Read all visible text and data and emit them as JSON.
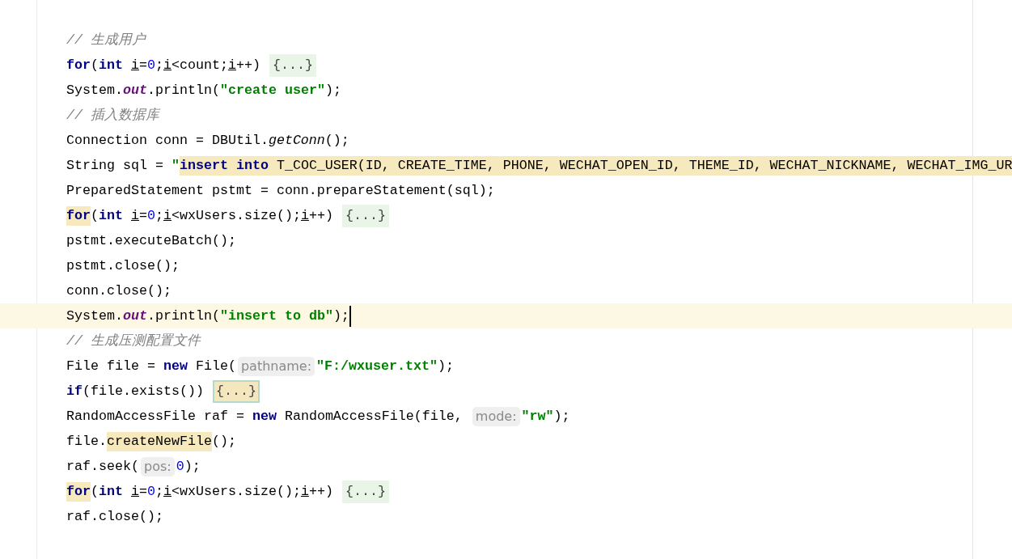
{
  "editor": {
    "lines": [
      {
        "current": false,
        "tokens": [
          {
            "kind": "comment",
            "text": "// 生成用户",
            "highlighted": false
          }
        ]
      },
      {
        "current": false,
        "tokens": [
          {
            "kind": "keyword",
            "text": "for",
            "highlighted": false
          },
          {
            "kind": "code",
            "text": "(",
            "highlighted": false
          },
          {
            "kind": "keyword",
            "text": "int ",
            "highlighted": false
          },
          {
            "kind": "var",
            "text": "i",
            "highlighted": false
          },
          {
            "kind": "code",
            "text": "=",
            "highlighted": false
          },
          {
            "kind": "number",
            "text": "0",
            "highlighted": false
          },
          {
            "kind": "code",
            "text": ";",
            "highlighted": false
          },
          {
            "kind": "var",
            "text": "i",
            "highlighted": false
          },
          {
            "kind": "code",
            "text": "<count;",
            "highlighted": false
          },
          {
            "kind": "var",
            "text": "i",
            "highlighted": false
          },
          {
            "kind": "code",
            "text": "++)",
            "highlighted": false
          },
          {
            "kind": "fold",
            "text": "{...}",
            "selected": false
          }
        ]
      },
      {
        "current": false,
        "tokens": [
          {
            "kind": "code",
            "text": "System.",
            "highlighted": false
          },
          {
            "kind": "field",
            "text": "out",
            "highlighted": false
          },
          {
            "kind": "code",
            "text": ".println(",
            "highlighted": false
          },
          {
            "kind": "string",
            "text": "\"create user\"",
            "highlighted": false
          },
          {
            "kind": "code",
            "text": ");",
            "highlighted": false
          }
        ]
      },
      {
        "current": false,
        "tokens": [
          {
            "kind": "comment",
            "text": "// 插入数据库",
            "highlighted": false
          }
        ]
      },
      {
        "current": false,
        "tokens": [
          {
            "kind": "code",
            "text": "Connection conn = DBUtil.",
            "highlighted": false
          },
          {
            "kind": "static",
            "text": "getConn",
            "highlighted": false
          },
          {
            "kind": "code",
            "text": "();",
            "highlighted": false
          }
        ]
      },
      {
        "current": false,
        "tokens": [
          {
            "kind": "code",
            "text": "String sql = ",
            "highlighted": false
          },
          {
            "kind": "string",
            "text": "\"",
            "highlighted": false
          },
          {
            "kind": "keyword",
            "text": "insert into",
            "highlighted": true
          },
          {
            "kind": "code",
            "text": " T_COC_USER(ID, CREATE_TIME, PHONE, WECHAT_OPEN_ID, THEME_ID, WECHAT_NICKNAME, WECHAT_IMG_UR",
            "highlighted": true
          }
        ]
      },
      {
        "current": false,
        "tokens": [
          {
            "kind": "code",
            "text": "PreparedStatement pstmt = conn.prepareStatement(sql);",
            "highlighted": false
          }
        ]
      },
      {
        "current": false,
        "tokens": [
          {
            "kind": "keyword",
            "text": "for",
            "highlighted": true
          },
          {
            "kind": "code",
            "text": "(",
            "highlighted": false
          },
          {
            "kind": "keyword",
            "text": "int ",
            "highlighted": false
          },
          {
            "kind": "var",
            "text": "i",
            "highlighted": false
          },
          {
            "kind": "code",
            "text": "=",
            "highlighted": false
          },
          {
            "kind": "number",
            "text": "0",
            "highlighted": false
          },
          {
            "kind": "code",
            "text": ";",
            "highlighted": false
          },
          {
            "kind": "var",
            "text": "i",
            "highlighted": false
          },
          {
            "kind": "code",
            "text": "<wxUsers.size();",
            "highlighted": false
          },
          {
            "kind": "var",
            "text": "i",
            "highlighted": false
          },
          {
            "kind": "code",
            "text": "++)",
            "highlighted": false
          },
          {
            "kind": "fold",
            "text": "{...}",
            "selected": false
          }
        ]
      },
      {
        "current": false,
        "tokens": [
          {
            "kind": "code",
            "text": "pstmt.executeBatch();",
            "highlighted": false
          }
        ]
      },
      {
        "current": false,
        "tokens": [
          {
            "kind": "code",
            "text": "pstmt.close();",
            "highlighted": false
          }
        ]
      },
      {
        "current": false,
        "tokens": [
          {
            "kind": "code",
            "text": "conn.close();",
            "highlighted": false
          }
        ]
      },
      {
        "current": true,
        "tokens": [
          {
            "kind": "code",
            "text": "System.",
            "highlighted": false
          },
          {
            "kind": "field",
            "text": "out",
            "highlighted": false
          },
          {
            "kind": "code",
            "text": ".println(",
            "highlighted": false
          },
          {
            "kind": "string",
            "text": "\"insert to db\"",
            "highlighted": false
          },
          {
            "kind": "code",
            "text": ");",
            "highlighted": false
          }
        ]
      },
      {
        "current": false,
        "tokens": [
          {
            "kind": "comment",
            "text": "// 生成压测配置文件",
            "highlighted": false
          }
        ]
      },
      {
        "current": false,
        "tokens": [
          {
            "kind": "code",
            "text": "File file = ",
            "highlighted": false
          },
          {
            "kind": "keyword",
            "text": "new",
            "highlighted": false
          },
          {
            "kind": "code",
            "text": " File(",
            "highlighted": false
          },
          {
            "kind": "hint",
            "text": "pathname:"
          },
          {
            "kind": "string",
            "text": "\"F:/wxuser.txt\"",
            "highlighted": false
          },
          {
            "kind": "code",
            "text": ");",
            "highlighted": false
          }
        ]
      },
      {
        "current": false,
        "tokens": [
          {
            "kind": "keyword",
            "text": "if",
            "highlighted": false
          },
          {
            "kind": "code",
            "text": "(file.exists())",
            "highlighted": false
          },
          {
            "kind": "fold",
            "text": "{...}",
            "selected": true
          }
        ]
      },
      {
        "current": false,
        "tokens": [
          {
            "kind": "code",
            "text": "RandomAccessFile raf = ",
            "highlighted": false
          },
          {
            "kind": "keyword",
            "text": "new",
            "highlighted": false
          },
          {
            "kind": "code",
            "text": " RandomAccessFile(file, ",
            "highlighted": false
          },
          {
            "kind": "hint",
            "text": "mode:"
          },
          {
            "kind": "string",
            "text": "\"rw\"",
            "highlighted": false
          },
          {
            "kind": "code",
            "text": ");",
            "highlighted": false
          }
        ]
      },
      {
        "current": false,
        "tokens": [
          {
            "kind": "code",
            "text": "file.",
            "highlighted": false
          },
          {
            "kind": "code",
            "text": "createNewFile",
            "highlighted": true
          },
          {
            "kind": "code",
            "text": "();",
            "highlighted": false
          }
        ]
      },
      {
        "current": false,
        "tokens": [
          {
            "kind": "code",
            "text": "raf.seek(",
            "highlighted": false
          },
          {
            "kind": "hint",
            "text": "pos:"
          },
          {
            "kind": "number",
            "text": "0",
            "highlighted": false
          },
          {
            "kind": "code",
            "text": ");",
            "highlighted": false
          }
        ]
      },
      {
        "current": false,
        "tokens": [
          {
            "kind": "keyword",
            "text": "for",
            "highlighted": true
          },
          {
            "kind": "code",
            "text": "(",
            "highlighted": false
          },
          {
            "kind": "keyword",
            "text": "int ",
            "highlighted": false
          },
          {
            "kind": "var",
            "text": "i",
            "highlighted": false
          },
          {
            "kind": "code",
            "text": "=",
            "highlighted": false
          },
          {
            "kind": "number",
            "text": "0",
            "highlighted": false
          },
          {
            "kind": "code",
            "text": ";",
            "highlighted": false
          },
          {
            "kind": "var",
            "text": "i",
            "highlighted": false
          },
          {
            "kind": "code",
            "text": "<wxUsers.size();",
            "highlighted": false
          },
          {
            "kind": "var",
            "text": "i",
            "highlighted": false
          },
          {
            "kind": "code",
            "text": "++)",
            "highlighted": false
          },
          {
            "kind": "fold",
            "text": "{...}",
            "selected": false
          }
        ]
      },
      {
        "current": false,
        "tokens": [
          {
            "kind": "code",
            "text": "raf.close();",
            "highlighted": false
          }
        ]
      }
    ]
  }
}
